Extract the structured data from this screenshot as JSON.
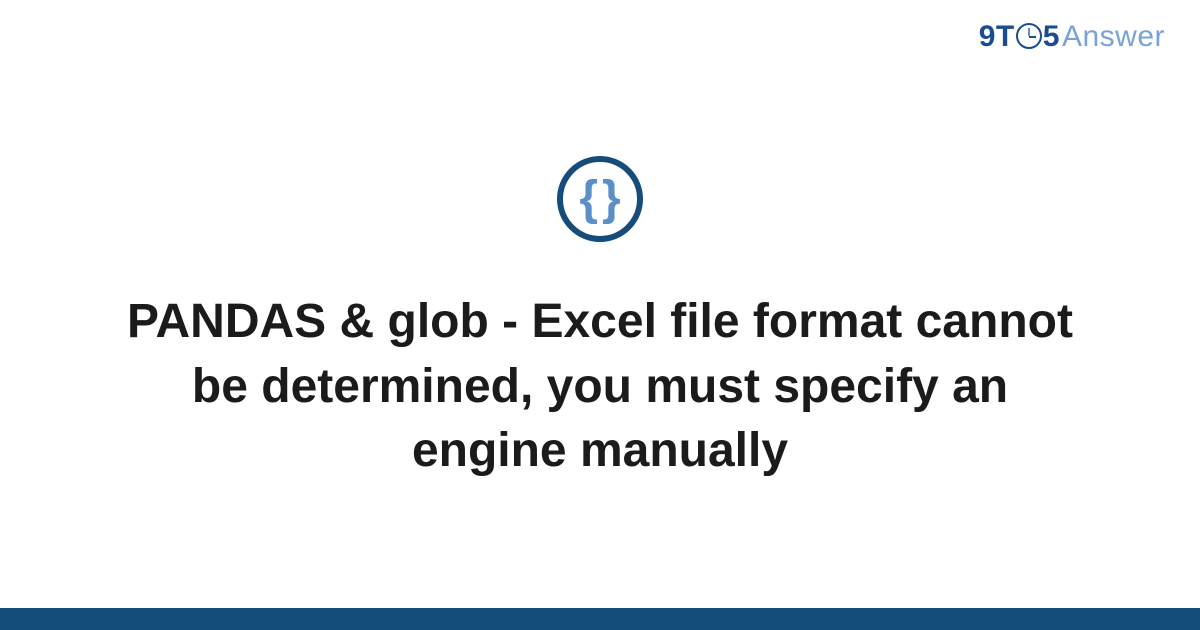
{
  "logo": {
    "part1": "9T",
    "part2": "5",
    "part3": "Answer"
  },
  "icon": {
    "left_brace": "{",
    "right_brace": "}"
  },
  "title": "PANDAS & glob - Excel file format cannot be determined, you must specify an engine manually",
  "colors": {
    "brand_dark": "#154c79",
    "brand_mid": "#1a4d8f",
    "brand_light": "#5a8fc7",
    "text": "#1b1b1b"
  }
}
